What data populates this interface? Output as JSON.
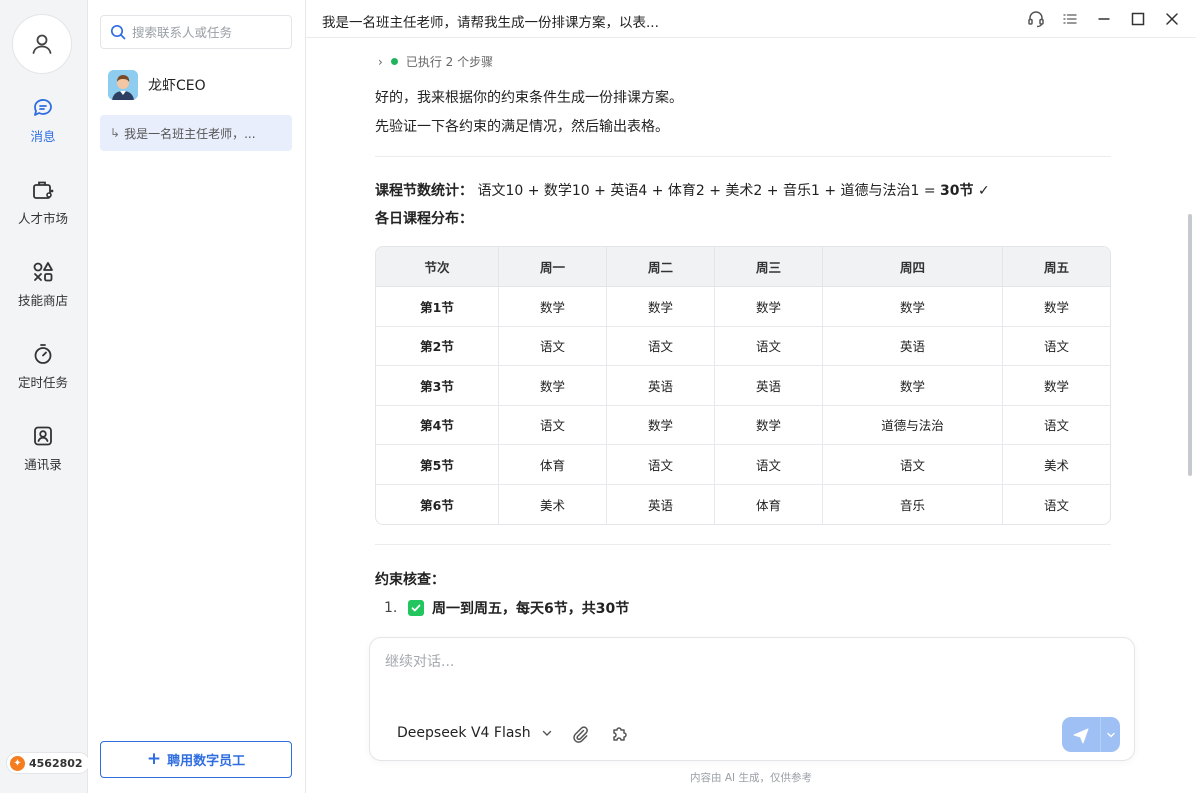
{
  "rail": {
    "items": [
      {
        "label": "消息",
        "icon": "message-icon"
      },
      {
        "label": "人才市场",
        "icon": "briefcase-icon"
      },
      {
        "label": "技能商店",
        "icon": "apps-icon"
      },
      {
        "label": "定时任务",
        "icon": "timer-icon"
      },
      {
        "label": "通讯录",
        "icon": "contacts-icon"
      }
    ],
    "points": "4562802",
    "accent": "#2f6de1"
  },
  "contacts": {
    "search_placeholder": "搜索联系人或任务",
    "contact_name": "龙虾CEO",
    "task_preview": "我是一名班主任老师，...",
    "hire_label": "聘用数字员工"
  },
  "window": {
    "title": "我是一名班主任老师，请帮我生成一份排课方案，以表..."
  },
  "message": {
    "steps": "已执行 2 个步骤",
    "p1": "好的，我来根据你的约束条件生成一份排课方案。",
    "p2": "先验证一下各约束的满足情况，然后输出表格。",
    "stats_label": "课程节数统计：",
    "stats_formula": "语文10 + 数学10 + 英语4 + 体育2 + 美术2 + 音乐1 + 道德与法治1 =",
    "stats_total": "30节",
    "stats_check": "✓",
    "dist_label": "各日课程分布：",
    "table": {
      "headers": [
        "节次",
        "周一",
        "周二",
        "周三",
        "周四",
        "周五"
      ],
      "rows": [
        [
          "第1节",
          "数学",
          "数学",
          "数学",
          "数学",
          "数学"
        ],
        [
          "第2节",
          "语文",
          "语文",
          "语文",
          "英语",
          "语文"
        ],
        [
          "第3节",
          "数学",
          "英语",
          "英语",
          "数学",
          "数学"
        ],
        [
          "第4节",
          "语文",
          "数学",
          "数学",
          "道德与法治",
          "语文"
        ],
        [
          "第5节",
          "体育",
          "语文",
          "语文",
          "语文",
          "美术"
        ],
        [
          "第6节",
          "美术",
          "英语",
          "体育",
          "音乐",
          "语文"
        ]
      ]
    },
    "constraint_heading": "约束核查：",
    "constraint_1_num": "1.",
    "constraint_1_text": "周一到周五，每天6节，共30节"
  },
  "composer": {
    "placeholder": "继续对话...",
    "model": "Deepseek V4 Flash",
    "disclaimer": "内容由 AI 生成，仅供参考"
  }
}
